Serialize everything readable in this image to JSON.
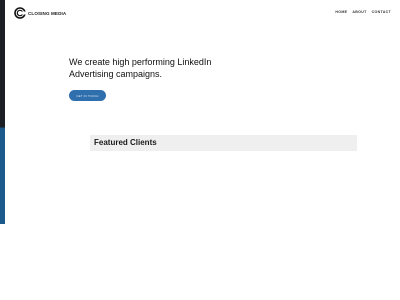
{
  "brand": {
    "name": "CLOSING MEDIA",
    "logo_icon": "c-ring-logo-icon",
    "logo_color": "#111111"
  },
  "nav": {
    "items": [
      {
        "label": "HOME"
      },
      {
        "label": "ABOUT"
      },
      {
        "label": "CONTACT"
      }
    ]
  },
  "hero": {
    "heading_line1": "We create high performing LinkedIn",
    "heading_line2": "Advertising campaigns.",
    "cta_label": "GET IN TOUCH",
    "cta_color": "#2f6fae"
  },
  "featured": {
    "title": "Featured Clients",
    "background": "#efefef"
  },
  "colors": {
    "side_strip_dark": "#1c2024",
    "side_strip_blue": "#1b5a8a"
  }
}
